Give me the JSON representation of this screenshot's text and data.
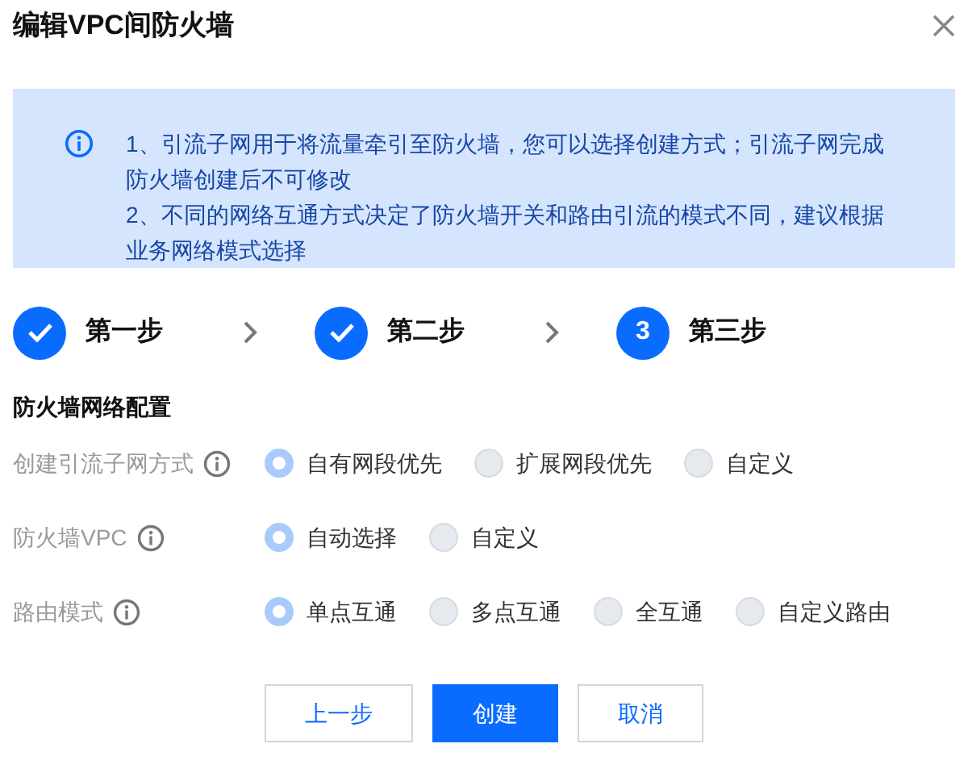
{
  "dialog": {
    "title": "编辑VPC间防火墙"
  },
  "notice": {
    "lines": [
      "1、引流子网用于将流量牵引至防火墙，您可以选择创建方式；引流子网完成防火墙创建后不可修改",
      "2、不同的网络互通方式决定了防火墙开关和路由引流的模式不同，建议根据业务网络模式选择"
    ]
  },
  "steps": [
    {
      "label": "第一步",
      "completed": true
    },
    {
      "label": "第二步",
      "completed": true
    },
    {
      "label": "第三步",
      "completed": false,
      "number": "3"
    }
  ],
  "section": {
    "title": "防火墙网络配置"
  },
  "fields": [
    {
      "label": "创建引流子网方式",
      "options": [
        {
          "label": "自有网段优先",
          "selected": true
        },
        {
          "label": "扩展网段优先",
          "selected": false
        },
        {
          "label": "自定义",
          "selected": false
        }
      ]
    },
    {
      "label": "防火墙VPC",
      "options": [
        {
          "label": "自动选择",
          "selected": true
        },
        {
          "label": "自定义",
          "selected": false
        }
      ]
    },
    {
      "label": "路由模式",
      "options": [
        {
          "label": "单点互通",
          "selected": true
        },
        {
          "label": "多点互通",
          "selected": false
        },
        {
          "label": "全互通",
          "selected": false
        },
        {
          "label": "自定义路由",
          "selected": false
        }
      ]
    }
  ],
  "buttons": [
    {
      "label": "上一步",
      "kind": "secondary"
    },
    {
      "label": "创建",
      "kind": "primary"
    },
    {
      "label": "取消",
      "kind": "secondary"
    }
  ]
}
